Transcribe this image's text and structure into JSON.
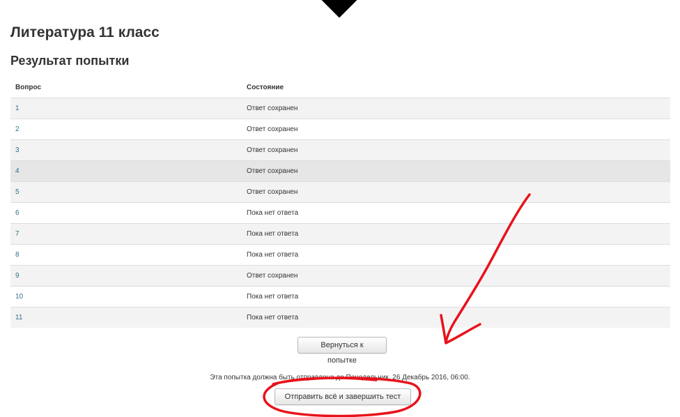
{
  "page": {
    "course_title": "Литература 11 класс",
    "section_title": "Результат попытки"
  },
  "table": {
    "headers": {
      "question": "Вопрос",
      "status": "Состояние"
    },
    "rows": [
      {
        "q": "1",
        "status": "Ответ сохранен"
      },
      {
        "q": "2",
        "status": "Ответ сохранен"
      },
      {
        "q": "3",
        "status": "Ответ сохранен"
      },
      {
        "q": "4",
        "status": "Ответ сохранен"
      },
      {
        "q": "5",
        "status": "Ответ сохранен"
      },
      {
        "q": "6",
        "status": "Пока нет ответа"
      },
      {
        "q": "7",
        "status": "Пока нет ответа"
      },
      {
        "q": "8",
        "status": "Пока нет ответа"
      },
      {
        "q": "9",
        "status": "Ответ сохранен"
      },
      {
        "q": "10",
        "status": "Пока нет ответа"
      },
      {
        "q": "11",
        "status": "Пока нет ответа"
      }
    ]
  },
  "actions": {
    "return_label": "Вернуться к попытке",
    "deadline_note": "Эта попытка должна быть отправлена до Понедельник, 26 Декабрь 2016, 06:00.",
    "submit_label": "Отправить всё и завершить тест"
  },
  "colors": {
    "link": "#2f6f89",
    "annotation": "#e8121b"
  }
}
